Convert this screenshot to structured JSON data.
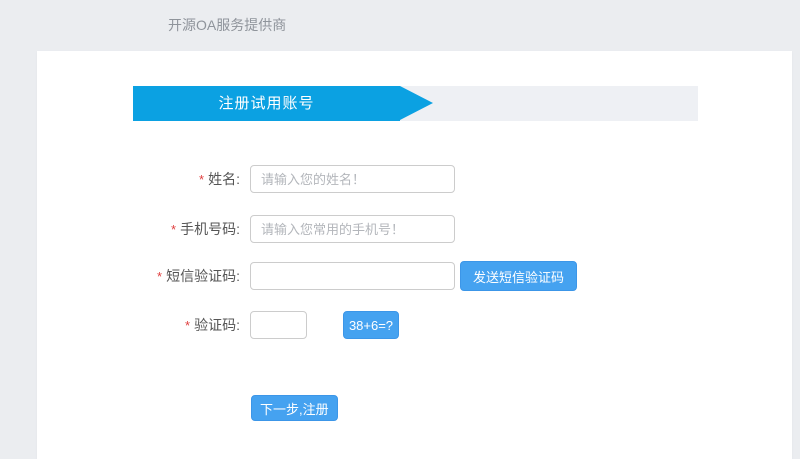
{
  "header": {
    "title": "开源OA服务提供商"
  },
  "banner": {
    "title": "注册试用账号"
  },
  "form": {
    "fields": [
      {
        "required": "*",
        "label": "姓名:",
        "placeholder": "请输入您的姓名！"
      },
      {
        "required": "*",
        "label": "手机号码:",
        "placeholder": "请输入您常用的手机号！"
      },
      {
        "required": "*",
        "label": "短信验证码:",
        "placeholder": "",
        "button": "发送短信验证码"
      },
      {
        "required": "*",
        "label": "验证码:",
        "placeholder": "",
        "button": "38+6=?"
      }
    ],
    "submit_label": "下一步,注册"
  },
  "colors": {
    "page_bg": "#ebedf0",
    "header_text": "#8f949b",
    "banner_strip": "#eef0f4",
    "banner_blue": "#0ba1e2",
    "button_blue": "#45a2f0",
    "button_blue_border": "#3c96e8",
    "required_red": "#e03e3e"
  }
}
